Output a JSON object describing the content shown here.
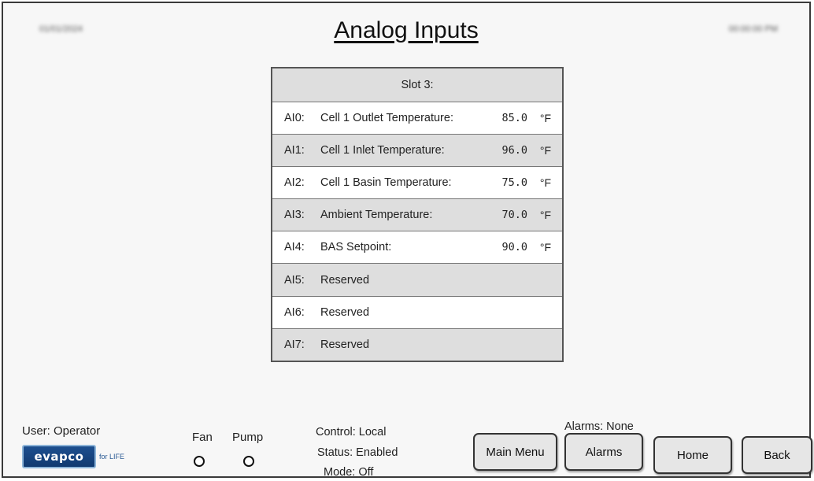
{
  "header": {
    "date": "01/01/2024",
    "title": "Analog Inputs",
    "time": "00:00:00 PM"
  },
  "table": {
    "header": "Slot 3:",
    "rows": [
      {
        "code": "AI0:",
        "desc": "Cell 1 Outlet Temperature:",
        "value": "85.0",
        "unit": "°F"
      },
      {
        "code": "AI1:",
        "desc": "Cell 1 Inlet Temperature:",
        "value": "96.0",
        "unit": "°F"
      },
      {
        "code": "AI2:",
        "desc": "Cell 1 Basin Temperature:",
        "value": "75.0",
        "unit": "°F"
      },
      {
        "code": "AI3:",
        "desc": "Ambient Temperature:",
        "value": "70.0",
        "unit": "°F"
      },
      {
        "code": "AI4:",
        "desc": "BAS Setpoint:",
        "value": "90.0",
        "unit": "°F"
      },
      {
        "code": "AI5:",
        "desc": "Reserved"
      },
      {
        "code": "AI6:",
        "desc": "Reserved"
      },
      {
        "code": "AI7:",
        "desc": "Reserved"
      }
    ]
  },
  "footer": {
    "user": "User: Operator",
    "logo_text": "evapco",
    "logo_sub": "for LIFE",
    "fan_label": "Fan",
    "pump_label": "Pump",
    "control": "Control: Local",
    "status": "Status: Enabled",
    "mode": "Mode:  Off",
    "alarms_summary": "Alarms: None",
    "buttons": {
      "main_menu": "Main Menu",
      "alarms": "Alarms",
      "home": "Home",
      "back": "Back"
    }
  }
}
